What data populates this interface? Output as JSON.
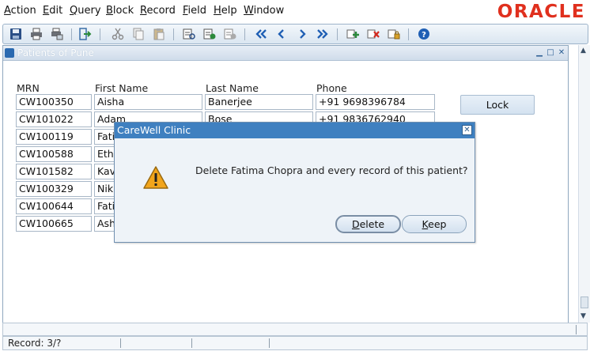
{
  "menu": [
    {
      "mnemonic": "A",
      "rest": "ction"
    },
    {
      "mnemonic": "E",
      "rest": "dit"
    },
    {
      "mnemonic": "Q",
      "rest": "uery"
    },
    {
      "mnemonic": "B",
      "rest": "lock"
    },
    {
      "mnemonic": "R",
      "rest": "ecord"
    },
    {
      "mnemonic": "F",
      "rest": "ield"
    },
    {
      "mnemonic": "H",
      "rest": "elp"
    },
    {
      "mnemonic": "W",
      "rest": "indow"
    }
  ],
  "brand": {
    "logo_text": "ORACLE",
    "color": "#e0301e"
  },
  "toolbar": {
    "icons": [
      "save-icon",
      "print-icon",
      "print-setup-icon",
      "exit-icon",
      "cut-icon",
      "copy-icon",
      "paste-icon",
      "enter-query-icon",
      "execute-query-icon",
      "cancel-query-icon",
      "first-record-icon",
      "previous-record-icon",
      "next-record-icon",
      "last-record-icon",
      "insert-record-icon",
      "delete-record-icon",
      "lock-record-icon",
      "help-icon"
    ]
  },
  "form": {
    "title": "Patients of Pune",
    "columns": {
      "mrn": "MRN",
      "first": "First Name",
      "last": "Last Name",
      "phone": "Phone"
    },
    "rows": [
      {
        "mrn": "CW100350",
        "first": "Aisha",
        "last": "Banerjee",
        "phone": "+91 9698396784"
      },
      {
        "mrn": "CW101022",
        "first": "Adam",
        "last": "Bose",
        "phone": "+91 9836762940"
      },
      {
        "mrn": "CW100119",
        "first": "Fati",
        "last": "",
        "phone": ""
      },
      {
        "mrn": "CW100588",
        "first": "Eth",
        "last": "",
        "phone": ""
      },
      {
        "mrn": "CW101582",
        "first": "Kav",
        "last": "",
        "phone": ""
      },
      {
        "mrn": "CW100329",
        "first": "Nikh",
        "last": "",
        "phone": ""
      },
      {
        "mrn": "CW100644",
        "first": "Fati",
        "last": "",
        "phone": ""
      },
      {
        "mrn": "CW100665",
        "first": "Ash",
        "last": "",
        "phone": ""
      }
    ],
    "lock_label": "Lock"
  },
  "status": {
    "record": "Record: 3/?"
  },
  "dialog": {
    "title": "CareWell Clinic",
    "message": "Delete Fatima Chopra and every record of this patient?",
    "delete_mnemonic": "D",
    "delete_rest": "elete",
    "keep_mnemonic": "K",
    "keep_rest": "eep"
  }
}
